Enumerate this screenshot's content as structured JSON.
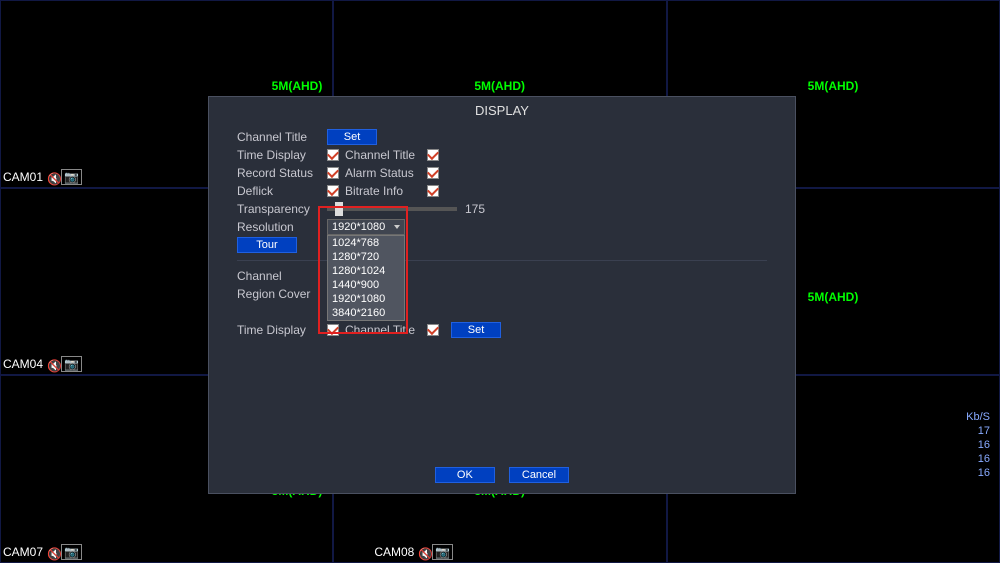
{
  "cameras": {
    "mode_label": "5M(AHD)",
    "cam01": "CAM01",
    "cam04": "CAM04",
    "cam07": "CAM07",
    "cam08": "CAM08"
  },
  "rates": {
    "header": "Kb/S",
    "v1": "17",
    "v2": "16",
    "v3": "16",
    "v4": "16"
  },
  "dialog": {
    "title": "DISPLAY",
    "channel_title_lbl": "Channel Title",
    "set_btn": "Set",
    "time_display_lbl": "Time Display",
    "channel_title_sub": "Channel Title",
    "record_status_lbl": "Record Status",
    "alarm_status_sub": "Alarm Status",
    "deflick_lbl": "Deflick",
    "bitrate_info_sub": "Bitrate Info",
    "transparency_lbl": "Transparency",
    "transparency_val": "175",
    "resolution_lbl": "Resolution",
    "resolution_sel": "1920*1080",
    "tour_btn": "Tour",
    "channel_lbl": "Channel",
    "region_cover_lbl": "Region Cover",
    "time_display2_lbl": "Time Display",
    "channel_title2_sub": "Channel Title",
    "set2_btn": "Set",
    "ok_btn": "OK",
    "cancel_btn": "Cancel",
    "res_options": {
      "o0": "1024*768",
      "o1": "1280*720",
      "o2": "1280*1024",
      "o3": "1440*900",
      "o4": "1920*1080",
      "o5": "3840*2160"
    }
  }
}
